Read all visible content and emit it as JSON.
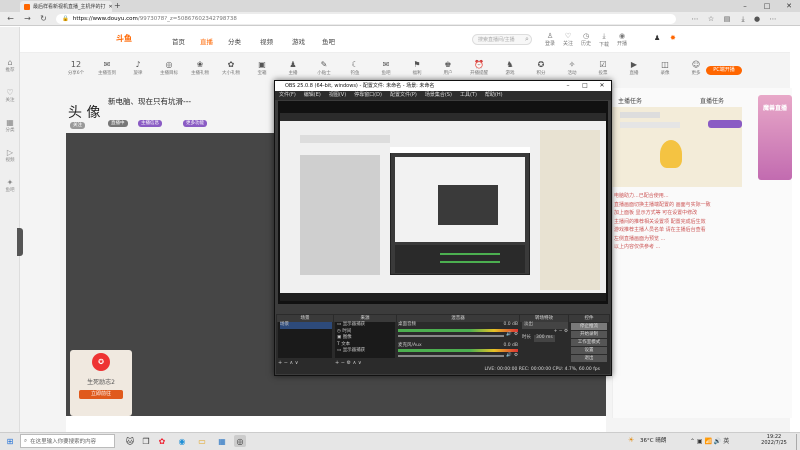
{
  "browser": {
    "tab_title": "最后样看新视机直播_主机伴的打",
    "url_host": "https://www.douyu.com",
    "url_path": "/9973078?_z=50867602342798738",
    "new_tab": "+"
  },
  "site": {
    "logo": "斗鱼",
    "nav": [
      "首页",
      "直播",
      "分类",
      "视频",
      "游戏",
      "鱼吧"
    ],
    "search_placeholder": "搜索直播间/主播",
    "nav_icons": [
      "登录",
      "关注",
      "历史",
      "下载",
      "开播"
    ]
  },
  "toolbar": {
    "items": [
      {
        "label": "12",
        "sub": "分享6个",
        "glyph": "12"
      },
      {
        "label": "主播签到",
        "glyph": "✉"
      },
      {
        "label": "旋律",
        "glyph": "♪"
      },
      {
        "label": "主播目标",
        "glyph": "◎"
      },
      {
        "label": "主播礼物",
        "glyph": "❀"
      },
      {
        "label": "大小礼物",
        "glyph": "✿"
      },
      {
        "label": "宝箱",
        "glyph": "▣"
      },
      {
        "label": "主播",
        "glyph": "♟"
      },
      {
        "label": "小贴士",
        "glyph": "✎"
      },
      {
        "label": "钓鱼",
        "glyph": "☾"
      },
      {
        "label": "鱼吧",
        "glyph": "✉"
      },
      {
        "label": "福利",
        "glyph": "⚑"
      },
      {
        "label": "用户",
        "glyph": "♚"
      },
      {
        "label": "开播提醒",
        "glyph": "⏰"
      },
      {
        "label": "游戏",
        "glyph": "♞"
      },
      {
        "label": "积分",
        "glyph": "✪"
      },
      {
        "label": "活动",
        "glyph": "✧"
      },
      {
        "label": "投票",
        "glyph": "☑"
      },
      {
        "label": "直播",
        "glyph": "▶"
      },
      {
        "label": "录像",
        "glyph": "◫"
      },
      {
        "label": "更多",
        "glyph": "☺"
      }
    ],
    "pc_button": "PC端开播"
  },
  "streamer": {
    "name": "头 像",
    "title": "新电脑、现在只有坑滑---",
    "chips": [
      "关注",
      "直播中",
      "主播信息",
      "更多功能"
    ]
  },
  "right_panel": {
    "tabs": [
      "主播任务",
      "直播任务"
    ],
    "side_banner": "魔兽直播",
    "text_lines": [
      "电脑助力...已配合使用...",
      "直播画面切换主播端配置的 画面与实际一致",
      "加上面板 显示方式等 可在设置中修改",
      "主播间的推荐相关设置项 配置完成后生效",
      "游戏推荐主播人员名单 请在主播后台查看",
      "左侧直播画面为预览 ...",
      "以上内容仅供参考 ..."
    ]
  },
  "sticker": {
    "title": "生死励志2",
    "button": "立即前往"
  },
  "obs": {
    "title": "OBS 25.0.8 (64-bit, windows) - 配置文件: 未命名 - 场景: 未命名",
    "menu": [
      "文件(F)",
      "编辑(E)",
      "视图(V)",
      "停靠窗口(D)",
      "配置文件(P)",
      "场景集合(S)",
      "工具(T)",
      "帮助(H)"
    ],
    "docks": {
      "scenes": {
        "title": "场景",
        "items": [
          "场景"
        ]
      },
      "sources": {
        "title": "来源",
        "items": [
          "显示器捕获",
          "时间",
          "图像",
          "文本",
          "显示器捕获"
        ]
      },
      "mixer": {
        "title": "混音器",
        "items": [
          {
            "name": "桌面音频",
            "db": "0.0 dB"
          },
          {
            "name": "麦克风/Aux",
            "db": "0.0 dB"
          }
        ]
      },
      "transitions": {
        "title": "转场特效",
        "fade": "淡出",
        "duration_label": "时长",
        "duration": "300 ms"
      },
      "controls": {
        "title": "控件",
        "buttons": [
          "停止推流",
          "开始录制",
          "工作室模式",
          "设置",
          "退出"
        ]
      }
    },
    "status": "LIVE: 00:00:00   REC: 00:00:00   CPU: 4.7%, 60.00 fps"
  },
  "taskbar": {
    "search": "在这里输入你要搜索的内容",
    "weather": "36°C 晴朗",
    "time": "19:22",
    "date": "2022/7/25"
  }
}
